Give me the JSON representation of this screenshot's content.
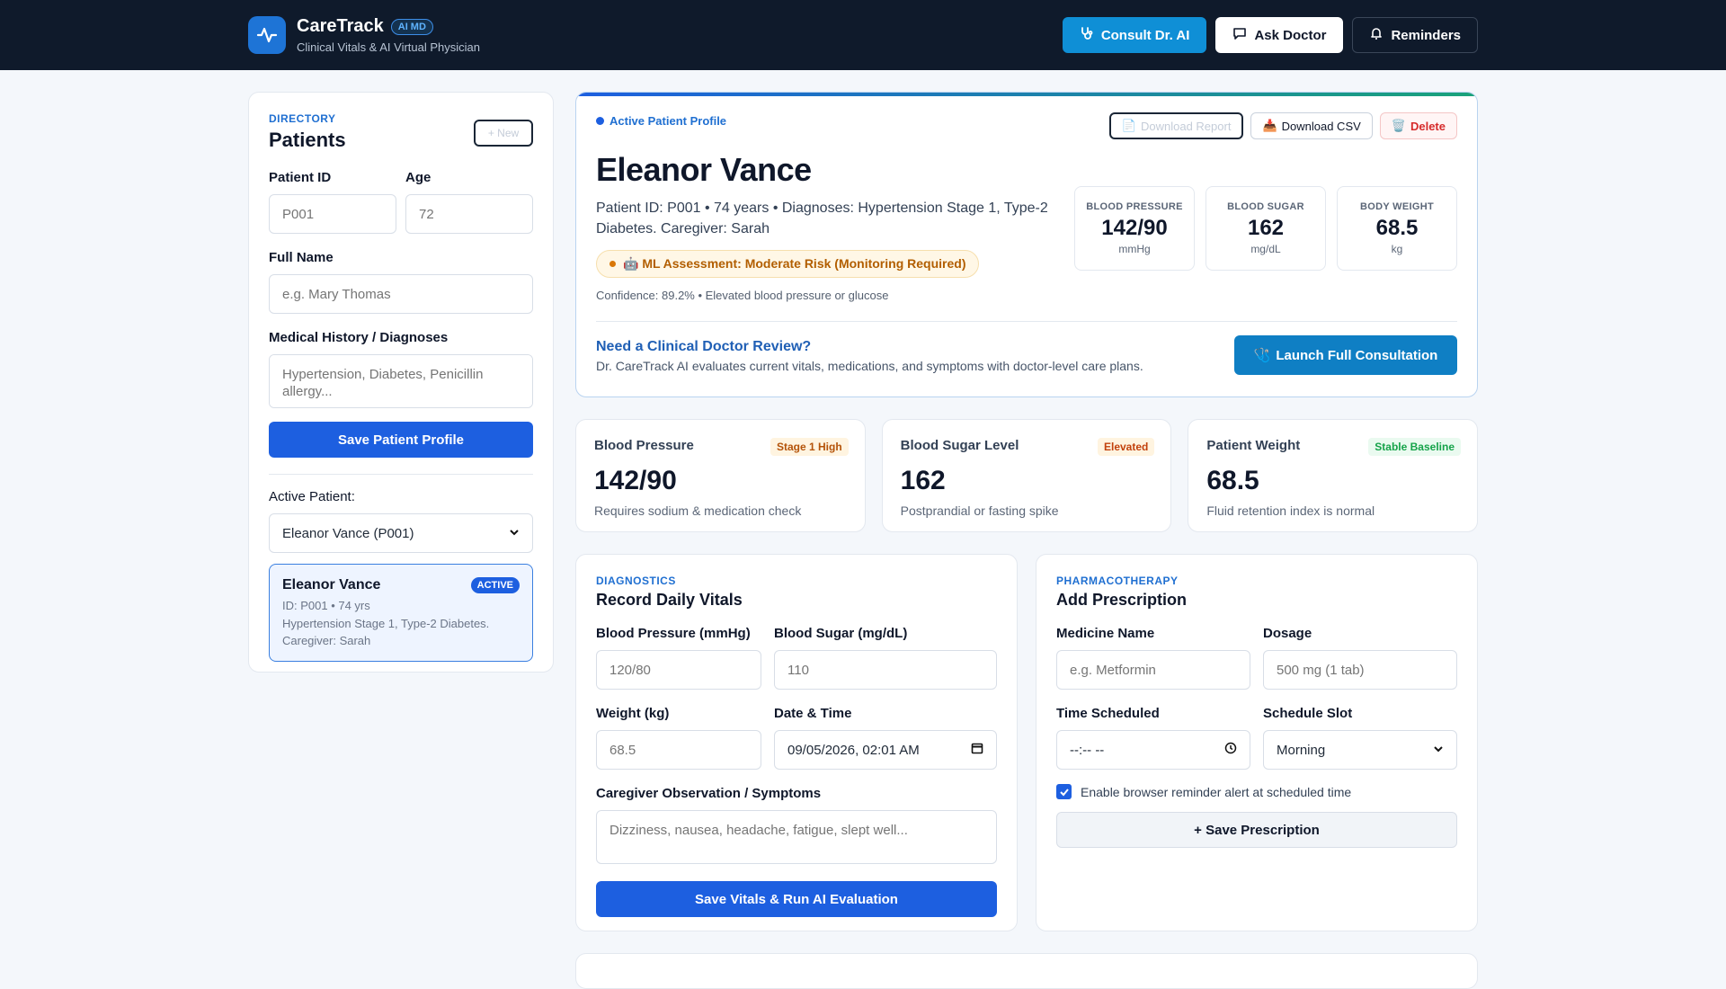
{
  "header": {
    "brand_name": "CareTrack",
    "brand_badge": "AI MD",
    "brand_subtitle": "Clinical Vitals & AI Virtual Physician",
    "consult_label": "Consult Dr. AI",
    "ask_label": "Ask Doctor",
    "reminders_label": "Reminders"
  },
  "sidebar": {
    "eyebrow": "DIRECTORY",
    "title": "Patients",
    "new_label": "+ New",
    "patient_id_label": "Patient ID",
    "patient_id_placeholder": "P001",
    "age_label": "Age",
    "age_placeholder": "72",
    "full_name_label": "Full Name",
    "full_name_placeholder": "e.g. Mary Thomas",
    "history_label": "Medical History / Diagnoses",
    "history_placeholder": "Hypertension, Diabetes, Penicillin allergy...",
    "save_label": "Save Patient Profile",
    "active_patient_label": "Active Patient:",
    "active_patient_value": "Eleanor Vance (P001)",
    "card": {
      "name": "Eleanor Vance",
      "badge": "ACTIVE",
      "id_line": "ID: P001 • 74 yrs",
      "history_line": "Hypertension Stage 1, Type-2 Diabetes.",
      "caregiver_line": "Caregiver: Sarah"
    }
  },
  "profile": {
    "active_label": "Active Patient Profile",
    "download_report": "Download Report",
    "download_csv": "Download CSV",
    "delete": "Delete",
    "name": "Eleanor Vance",
    "meta": "Patient ID: P001 • 74 years • Diagnoses: Hypertension Stage 1, Type-2 Diabetes. Caregiver: Sarah",
    "risk": "🤖 ML Assessment: Moderate Risk (Monitoring Required)",
    "confidence": "Confidence: 89.2% • Elevated blood pressure or glucose",
    "mini": [
      {
        "label": "BLOOD PRESSURE",
        "value": "142/90",
        "unit": "mmHg"
      },
      {
        "label": "BLOOD SUGAR",
        "value": "162",
        "unit": "mg/dL"
      },
      {
        "label": "BODY WEIGHT",
        "value": "68.5",
        "unit": "kg"
      }
    ],
    "review_title": "Need a Clinical Doctor Review?",
    "review_sub": "Dr. CareTrack AI evaluates current vitals, medications, and symptoms with doctor-level care plans.",
    "launch_label": "Launch Full Consultation"
  },
  "stats": [
    {
      "label": "Blood Pressure",
      "tag": "Stage 1 High",
      "value": "142/90",
      "note": "Requires sodium & medication check",
      "tag_color": "#b45309",
      "tag_bg": "#fff4e0"
    },
    {
      "label": "Blood Sugar Level",
      "tag": "Elevated",
      "value": "162",
      "note": "Postprandial or fasting spike",
      "tag_color": "#c2410c",
      "tag_bg": "#fff4e0"
    },
    {
      "label": "Patient Weight",
      "tag": "Stable Baseline",
      "value": "68.5",
      "note": "Fluid retention index is normal",
      "tag_color": "#16a34a",
      "tag_bg": "#eafaf0"
    }
  ],
  "vitals": {
    "eyebrow": "DIAGNOSTICS",
    "title": "Record Daily Vitals",
    "bp_label": "Blood Pressure (mmHg)",
    "bp_placeholder": "120/80",
    "sugar_label": "Blood Sugar (mg/dL)",
    "sugar_placeholder": "110",
    "weight_label": "Weight (kg)",
    "weight_placeholder": "68.5",
    "datetime_label": "Date & Time",
    "datetime_value": "09/05/2026, 02:01 AM",
    "symptoms_label": "Caregiver Observation / Symptoms",
    "symptoms_placeholder": "Dizziness, nausea, headache, fatigue, slept well...",
    "submit_label": "Save Vitals & Run AI Evaluation"
  },
  "prescription": {
    "eyebrow": "PHARMACOTHERAPY",
    "title": "Add Prescription",
    "medicine_label": "Medicine Name",
    "medicine_placeholder": "e.g. Metformin",
    "dosage_label": "Dosage",
    "dosage_placeholder": "500 mg (1 tab)",
    "time_label": "Time Scheduled",
    "time_placeholder": "--:-- --",
    "slot_label": "Schedule Slot",
    "slot_value": "Morning",
    "reminder_label": "Enable browser reminder alert at scheduled time",
    "save_label": "+ Save Prescription"
  },
  "colors": {
    "topbar": "#0f1a2b",
    "primary": "#1d5fe0",
    "consult": "#0f8fd6"
  }
}
